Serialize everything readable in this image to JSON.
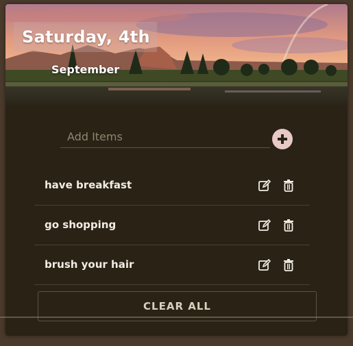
{
  "header": {
    "date_day": "Saturday, 4th",
    "date_month": "September"
  },
  "add": {
    "placeholder": "Add Items",
    "button_icon": "plus-circle-icon"
  },
  "items": [
    {
      "label": "have breakfast",
      "edit_icon": "edit-icon",
      "delete_icon": "trash-icon"
    },
    {
      "label": "go shopping",
      "edit_icon": "edit-icon",
      "delete_icon": "trash-icon"
    },
    {
      "label": "brush your hair",
      "edit_icon": "edit-icon",
      "delete_icon": "trash-icon"
    }
  ],
  "clear_label": "CLEAR ALL",
  "colors": {
    "panel": "#2a2215",
    "accent": "#e7c9c5",
    "text": "#f2ede4"
  }
}
